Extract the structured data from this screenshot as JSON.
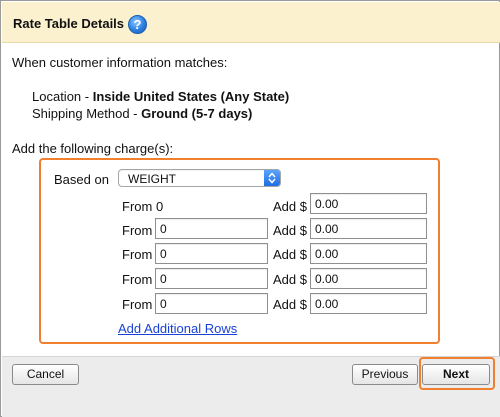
{
  "header": {
    "title": "Rate Table Details",
    "help_glyph": "?"
  },
  "intro": "When customer information matches:",
  "criteria": {
    "location_label": "Location - ",
    "location_value": "Inside United States (Any State)",
    "method_label": "Shipping Method - ",
    "method_value": "Ground (5-7 days)"
  },
  "charges": {
    "heading": "Add the following charge(s):",
    "based_on_label": "Based on",
    "based_on_value": "WEIGHT",
    "first_row": {
      "from_label": "From",
      "from_value": "0",
      "add_label": "Add $",
      "add_value": "0.00"
    },
    "rows": [
      {
        "from_label": "From",
        "from_value": "0",
        "add_label": "Add $",
        "add_value": "0.00"
      },
      {
        "from_label": "From",
        "from_value": "0",
        "add_label": "Add $",
        "add_value": "0.00"
      },
      {
        "from_label": "From",
        "from_value": "0",
        "add_label": "Add $",
        "add_value": "0.00"
      },
      {
        "from_label": "From",
        "from_value": "0",
        "add_label": "Add $",
        "add_value": "0.00"
      }
    ],
    "add_rows_link": "Add Additional Rows"
  },
  "footer": {
    "cancel": "Cancel",
    "previous": "Previous",
    "next": "Next"
  },
  "colors": {
    "highlight": "#f08030",
    "header_bg": "#fbf1cf",
    "link": "#1a43d6"
  }
}
